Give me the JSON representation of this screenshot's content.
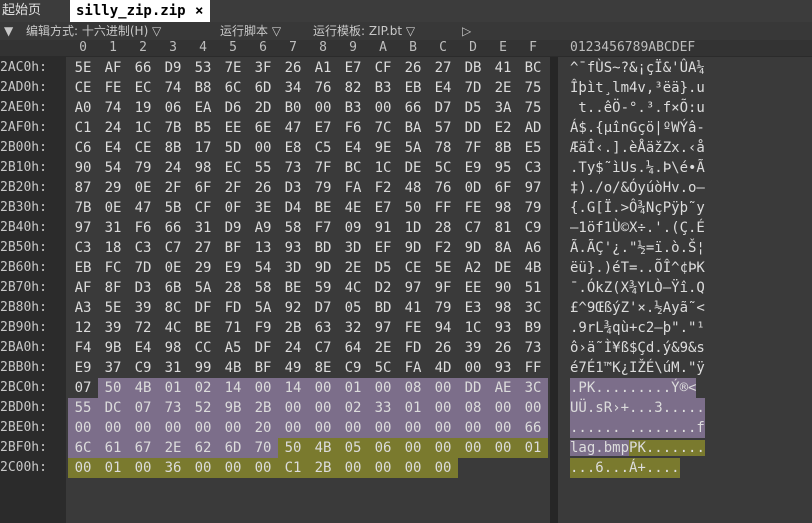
{
  "tabs": [
    {
      "label": "起始页"
    },
    {
      "label": "silly_zip.zip",
      "close": "×"
    }
  ],
  "toolbar": {
    "arrow": "▼",
    "edit_mode": "编辑方式: 十六进制(H) ▽",
    "run_script": "运行脚本 ▽",
    "run_template": "运行模板: ZIP.bt ▽",
    "play": "▷"
  },
  "hex_header": [
    "0",
    "1",
    "2",
    "3",
    "4",
    "5",
    "6",
    "7",
    "8",
    "9",
    "A",
    "B",
    "C",
    "D",
    "E",
    "F"
  ],
  "ascii_header": "0123456789ABCDEF",
  "rows": [
    {
      "off": "2AC0h:",
      "bytes": [
        "5E",
        "AF",
        "66",
        "D9",
        "53",
        "7E",
        "3F",
        "26",
        "A1",
        "E7",
        "CF",
        "26",
        "27",
        "DB",
        "41",
        "BC"
      ],
      "ascii": "^¯fÙS~?&¡çÏ&'ÛA¼"
    },
    {
      "off": "2AD0h:",
      "bytes": [
        "CE",
        "FE",
        "EC",
        "74",
        "B8",
        "6C",
        "6D",
        "34",
        "76",
        "82",
        "B3",
        "EB",
        "E4",
        "7D",
        "2E",
        "75"
      ],
      "ascii": "Îþìt¸lm4v‚³ëä}.u"
    },
    {
      "off": "2AE0h:",
      "bytes": [
        "A0",
        "74",
        "19",
        "06",
        "EA",
        "D6",
        "2D",
        "B0",
        "00",
        "B3",
        "00",
        "66",
        "D7",
        "D5",
        "3A",
        "75"
      ],
      "ascii": " t..êÖ-°.³.f×Õ:u"
    },
    {
      "off": "2AF0h:",
      "bytes": [
        "C1",
        "24",
        "1C",
        "7B",
        "B5",
        "EE",
        "6E",
        "47",
        "E7",
        "F6",
        "7C",
        "BA",
        "57",
        "DD",
        "E2",
        "AD"
      ],
      "ascii": "Á$.{µînGçö|ºWÝâ-"
    },
    {
      "off": "2B00h:",
      "bytes": [
        "C6",
        "E4",
        "CE",
        "8B",
        "17",
        "5D",
        "00",
        "E8",
        "C5",
        "E4",
        "9E",
        "5A",
        "78",
        "7F",
        "8B",
        "E5"
      ],
      "ascii": "ÆäÎ‹.].èÅäžZx.‹å"
    },
    {
      "off": "2B10h:",
      "bytes": [
        "90",
        "54",
        "79",
        "24",
        "98",
        "EC",
        "55",
        "73",
        "7F",
        "BC",
        "1C",
        "DE",
        "5C",
        "E9",
        "95",
        "C3"
      ],
      "ascii": ".Ty$˜ìUs.¼.Þ\\é•Ã"
    },
    {
      "off": "2B20h:",
      "bytes": [
        "87",
        "29",
        "0E",
        "2F",
        "6F",
        "2F",
        "26",
        "D3",
        "79",
        "FA",
        "F2",
        "48",
        "76",
        "0D",
        "6F",
        "97"
      ],
      "ascii": "‡)./o/&ÓyúòHv.o—"
    },
    {
      "off": "2B30h:",
      "bytes": [
        "7B",
        "0E",
        "47",
        "5B",
        "CF",
        "0F",
        "3E",
        "D4",
        "BE",
        "4E",
        "E7",
        "50",
        "FF",
        "FE",
        "98",
        "79"
      ],
      "ascii": "{.G[Ï.>Ô¾NçPÿþ˜y"
    },
    {
      "off": "2B40h:",
      "bytes": [
        "97",
        "31",
        "F6",
        "66",
        "31",
        "D9",
        "A9",
        "58",
        "F7",
        "09",
        "91",
        "1D",
        "28",
        "C7",
        "81",
        "C9"
      ],
      "ascii": "—1öf1Ù©X÷.'.(Ç.É"
    },
    {
      "off": "2B50h:",
      "bytes": [
        "C3",
        "18",
        "C3",
        "C7",
        "27",
        "BF",
        "13",
        "93",
        "BD",
        "3D",
        "EF",
        "9D",
        "F2",
        "9D",
        "8A",
        "A6"
      ],
      "ascii": "Ã.ÃÇ'¿.\"½=ï.ò.Š¦"
    },
    {
      "off": "2B60h:",
      "bytes": [
        "EB",
        "FC",
        "7D",
        "0E",
        "29",
        "E9",
        "54",
        "3D",
        "9D",
        "2E",
        "D5",
        "CE",
        "5E",
        "A2",
        "DE",
        "4B"
      ],
      "ascii": "ëü}.)éT=..ÕÎ^¢ÞK"
    },
    {
      "off": "2B70h:",
      "bytes": [
        "AF",
        "8F",
        "D3",
        "6B",
        "5A",
        "28",
        "58",
        "BE",
        "59",
        "4C",
        "D2",
        "97",
        "9F",
        "EE",
        "90",
        "51"
      ],
      "ascii": "¯.ÓkZ(X¾YLÒ—Ÿî.Q"
    },
    {
      "off": "2B80h:",
      "bytes": [
        "A3",
        "5E",
        "39",
        "8C",
        "DF",
        "FD",
        "5A",
        "92",
        "D7",
        "05",
        "BD",
        "41",
        "79",
        "E3",
        "98",
        "3C"
      ],
      "ascii": "£^9ŒßýZ'×.½Ayã˜<"
    },
    {
      "off": "2B90h:",
      "bytes": [
        "12",
        "39",
        "72",
        "4C",
        "BE",
        "71",
        "F9",
        "2B",
        "63",
        "32",
        "97",
        "FE",
        "94",
        "1C",
        "93",
        "B9"
      ],
      "ascii": ".9rL¾qù+c2—þ\".\"¹"
    },
    {
      "off": "2BA0h:",
      "bytes": [
        "F4",
        "9B",
        "E4",
        "98",
        "CC",
        "A5",
        "DF",
        "24",
        "C7",
        "64",
        "2E",
        "FD",
        "26",
        "39",
        "26",
        "73"
      ],
      "ascii": "ô›ä˜Ì¥ß$Çd.ý&9&s"
    },
    {
      "off": "2BB0h:",
      "bytes": [
        "E9",
        "37",
        "C9",
        "31",
        "99",
        "4B",
        "BF",
        "49",
        "8E",
        "C9",
        "5C",
        "FA",
        "4D",
        "00",
        "93",
        "FF"
      ],
      "ascii": "é7É1™K¿IŽÉ\\úM.\"ÿ"
    },
    {
      "off": "2BC0h:",
      "bytes": [
        "07",
        "50",
        "4B",
        "01",
        "02",
        "14",
        "00",
        "14",
        "00",
        "01",
        "00",
        "08",
        "00",
        "DD",
        "AE",
        "3C"
      ],
      "ascii": ".PK.........Ý®<"
    },
    {
      "off": "2BD0h:",
      "bytes": [
        "55",
        "DC",
        "07",
        "73",
        "52",
        "9B",
        "2B",
        "00",
        "00",
        "02",
        "33",
        "01",
        "00",
        "08",
        "00",
        "00"
      ],
      "ascii": "UÜ.sR›+...3....."
    },
    {
      "off": "2BE0h:",
      "bytes": [
        "00",
        "00",
        "00",
        "00",
        "00",
        "00",
        "20",
        "00",
        "00",
        "00",
        "00",
        "00",
        "00",
        "00",
        "00",
        "66"
      ],
      "ascii": "...... ........f"
    },
    {
      "off": "2BF0h:",
      "bytes": [
        "6C",
        "61",
        "67",
        "2E",
        "62",
        "6D",
        "70",
        "50",
        "4B",
        "05",
        "06",
        "00",
        "00",
        "00",
        "00",
        "01"
      ],
      "ascii": "lag.bmpPK......."
    },
    {
      "off": "2C00h:",
      "bytes": [
        "00",
        "01",
        "00",
        "36",
        "00",
        "00",
        "00",
        "C1",
        "2B",
        "00",
        "00",
        "00",
        "00",
        "",
        ""
      ],
      "ascii": "...6...Á+...."
    }
  ],
  "colors": {
    "highlight_central_dir": "#7c6e8a",
    "highlight_end_record": "#7a7a2e",
    "tab_active": "#ffffff"
  }
}
